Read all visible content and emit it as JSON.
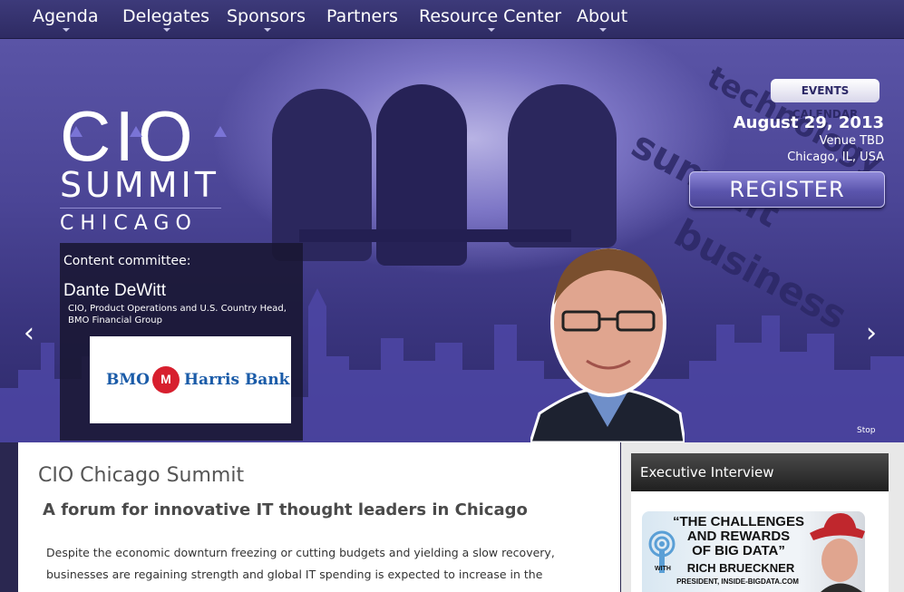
{
  "nav": {
    "items": [
      {
        "label": "Agenda",
        "has_dropdown": true
      },
      {
        "label": "Delegates",
        "has_dropdown": true
      },
      {
        "label": "Sponsors",
        "has_dropdown": true
      },
      {
        "label": "Partners",
        "has_dropdown": false
      },
      {
        "label": "Resource Center",
        "has_dropdown": true
      },
      {
        "label": "About",
        "has_dropdown": true
      }
    ]
  },
  "logo": {
    "line1": "CIO",
    "line2": "SUMMIT",
    "line3": "CHICAGO"
  },
  "event": {
    "calendar_button": "EVENTS CALENDAR",
    "date": "August 29, 2013",
    "venue": "Venue TBD",
    "location": "Chicago, IL, USA",
    "register_button": "REGISTER"
  },
  "hero_words": [
    "technology",
    "summit",
    "business"
  ],
  "committee": {
    "label": "Content committee:",
    "name": "Dante DeWitt",
    "title": "CIO, Product Operations and U.S. Country Head, BMO Financial Group",
    "sponsor_logo": {
      "left": "BMO",
      "right": "Harris Bank",
      "mark": "M"
    }
  },
  "slider": {
    "prev": "‹",
    "next": "›",
    "stop": "Stop"
  },
  "main": {
    "title": "CIO Chicago Summit",
    "subtitle": "A forum for innovative IT thought leaders in Chicago",
    "body": "Despite the economic downturn freezing or cutting budgets and yielding a slow recovery, businesses are regaining strength and global IT spending is expected to increase in the"
  },
  "sidebar": {
    "widget_title": "Executive Interview",
    "thumb": {
      "headline1": "“THE CHALLENGES",
      "headline2": "AND REWARDS",
      "headline3": "OF BIG DATA”",
      "with": "WITH",
      "name": "RICH BRUECKNER",
      "role": "PRESIDENT, INSIDE-BIGDATA.COM"
    }
  },
  "colors": {
    "nav": "#3d3a7a",
    "accent": "#5b55ad",
    "bmo_red": "#d71f2e",
    "bmo_blue": "#1a5ba8"
  }
}
